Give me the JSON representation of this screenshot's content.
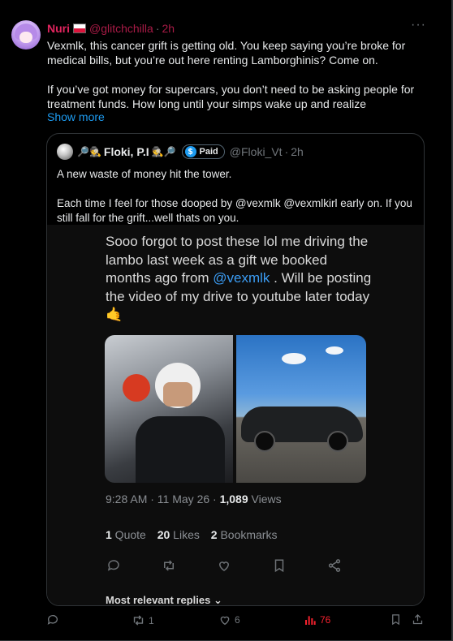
{
  "post": {
    "author_name": "Nuri",
    "handle": "@glitchchilla",
    "time": "2h",
    "more": "···",
    "paragraphs": [
      "Vexmlk, this cancer grift is getting old. You keep saying you’re broke for medical bills, but you’re out here renting Lamborghinis? Come on.",
      " If you’ve got money for supercars, you don’t need to be asking people for treatment funds. How long until your simps wake up and realize"
    ],
    "show_more": "Show more"
  },
  "quote": {
    "emoji_left": "🔎🕵",
    "author_name": "Floki, P.I",
    "emoji_right": "🕵🔎",
    "paid_label": "Paid",
    "handle": "@Floki_Vt",
    "time": "2h",
    "paragraphs": [
      "A new waste of money hit the tower.",
      "Each time I feel for those dooped by @vexmlk @vexmlkirl early on. If you still fall for the grift...well thats on you."
    ]
  },
  "media": {
    "caption_before": "Sooo forgot to post these lol me driving the lambo last week as a gift we booked months ago from ",
    "caption_mention": "@vexmlk",
    "caption_after": " . Will be posting the video of my drive to youtube later today 🤙",
    "timestamp": "9:28 AM · 11 May 26 · ",
    "views_count": "1,089",
    "views_label": " Views",
    "quotes_count": "1",
    "quotes_label": " Quote",
    "likes_count": "20",
    "likes_label": " Likes",
    "bookmarks_count": "2",
    "bookmarks_label": " Bookmarks",
    "relevant_label": "Most relevant replies ⌄"
  },
  "actions": {
    "reposts": "1",
    "likes": "6",
    "views": "76"
  },
  "colors": {
    "accent_red": "#e0245e",
    "link_blue": "#1d9bf0",
    "views_red": "#f4212e"
  }
}
